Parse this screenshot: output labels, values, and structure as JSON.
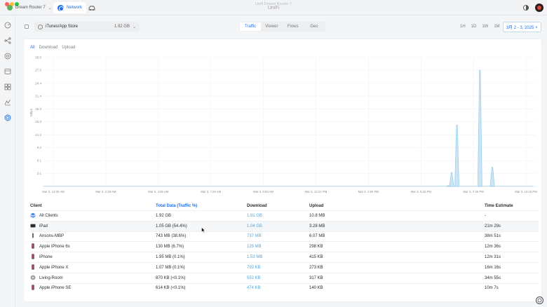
{
  "window": {
    "title": "Unifi Dream Router 7",
    "brand": "UniFi",
    "tabs": [
      {
        "label": "Dream Router 7"
      },
      {
        "label": "Network"
      }
    ]
  },
  "controls": {
    "app_name": "iTunes/App Store",
    "app_size": "1.92 GB",
    "view_tabs": [
      "Traffic",
      "Viewer",
      "Flows",
      "Geo"
    ],
    "active_view": "Traffic",
    "ranges": [
      "1H",
      "1D",
      "1W",
      "1M"
    ],
    "date_range": "3月 2 - 3, 2025",
    "clear": "×"
  },
  "filters": {
    "all": "All",
    "download": "Download",
    "upload": "Upload"
  },
  "chart_data": {
    "type": "area",
    "ylabel": "Mbps",
    "y_ticks": [
      "30.5",
      "27.5",
      "24.4",
      "21.4",
      "18.3",
      "15.3",
      "12.2",
      "9.2",
      "6.1",
      "3.1"
    ],
    "x_ticks": [
      "Mar 3, 12:00 AM",
      "Mar 3, 2:28 AM",
      "Mar 3, 4:56 AM",
      "Mar 3, 7:25 AM",
      "Mar 3, 9:53 AM",
      "Mar 3, 12:21 PM",
      "Mar 3, 2:50 PM",
      "Mar 3, 5:18 PM",
      "Mar 3, 7:46 PM",
      "Mar 3, 10:15 PM"
    ],
    "ylim": [
      0,
      30.5
    ],
    "series": [
      {
        "values": [
          {
            "x": "Mar 3, 6:35 PM",
            "y": 0.2
          },
          {
            "x": "Mar 3, 6:45 PM",
            "y": 3.3
          },
          {
            "x": "Mar 3, 7:00 PM",
            "y": 14.5
          },
          {
            "x": "Mar 3, 8:05 PM",
            "y": 27.5
          },
          {
            "x": "Mar 3, 8:40 PM",
            "y": 4.6
          }
        ]
      }
    ],
    "grid": true,
    "color": "#9fd0ea"
  },
  "table": {
    "headers": {
      "client": "Client",
      "total": "Total Data (Traffic %)",
      "download": "Download",
      "upload": "Upload",
      "time": "Time Estimate"
    },
    "rows": [
      {
        "client": "All Clients",
        "total": "1.92 GB",
        "download": "1.91 GB",
        "upload": "10.8 MB",
        "time": "-",
        "icon": "layers-icon"
      },
      {
        "client": "iPad",
        "total": "1.05 GB (54.4%)",
        "download": "1.04 GB",
        "upload": "3.28 MB",
        "time": "21m 29s",
        "icon": "tablet-icon"
      },
      {
        "client": "Ansons-MBP",
        "total": "743 MB (38.6%)",
        "download": "737 MB",
        "upload": "6.07 MB",
        "time": "38m 51s",
        "icon": "laptop-icon"
      },
      {
        "client": "Apple iPhone 6s",
        "total": "130 MB (6.7%)",
        "download": "129 MB",
        "upload": "298 KB",
        "time": "12m 36s",
        "icon": "phone-icon"
      },
      {
        "client": "iPhone",
        "total": "1.95 MB (0.1%)",
        "download": "1.53 MB",
        "upload": "415 KB",
        "time": "12m 31s",
        "icon": "phone-icon"
      },
      {
        "client": "Apple iPhone X",
        "total": "1.07 MB (0.1%)",
        "download": "793 KB",
        "upload": "273 KB",
        "time": "16m 16s",
        "icon": "phone-icon"
      },
      {
        "client": "Living-Room",
        "total": "870 KB (<0.1%)",
        "download": "552 KB",
        "upload": "317 KB",
        "time": "34m 55s",
        "icon": "speaker-icon"
      },
      {
        "client": "Apple iPhone SE",
        "total": "614 KB (<0.1%)",
        "download": "474 KB",
        "upload": "140 KB",
        "time": "10m 7s",
        "icon": "phone-icon"
      }
    ]
  }
}
